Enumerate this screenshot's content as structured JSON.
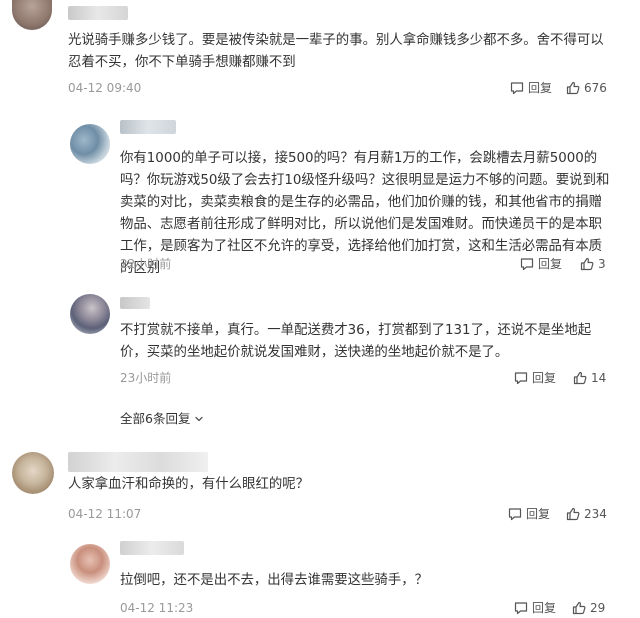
{
  "labels": {
    "reply": "回复",
    "more_replies": "全部6条回复"
  },
  "comments": [
    {
      "text": "光说骑手赚多少钱了。要是被传染就是一辈子的事。别人拿命赚钱多少都不多。舍不得可以忍着不买，你不下单骑手想赚都赚不到",
      "time": "04-12 09:40",
      "likes": "676"
    },
    {
      "text": "你有1000的单子可以接，接500的吗？有月薪1万的工作，会跳槽去月薪5000的吗？你玩游戏50级了会去打10级怪升级吗？这很明显是运力不够的问题。要说到和卖菜的对比，卖菜卖粮食的是生存的必需品，他们加价赚的钱，和其他省市的捐赠物品、志愿者前往形成了鲜明对比，所以说他们是发国难财。而快递员干的是本职工作，是顾客为了社区不允许的享受，选择给他们加打赏，这和生活必需品有本质的区别",
      "time": "22小时前",
      "likes": "3"
    },
    {
      "text": "不打赏就不接单，真行。一单配送费才36，打赏都到了131了，还说不是坐地起价，买菜的坐地起价就说发国难财，送快递的坐地起价就不是了。",
      "time": "23小时前",
      "likes": "14"
    },
    {
      "text": "人家拿血汗和命换的，有什么眼红的呢？",
      "time": "04-12 11:07",
      "likes": "234"
    },
    {
      "text": "拉倒吧，还不是出不去，出得去谁需要这些骑手，？",
      "time": "04-12 11:23",
      "likes": "29"
    }
  ]
}
